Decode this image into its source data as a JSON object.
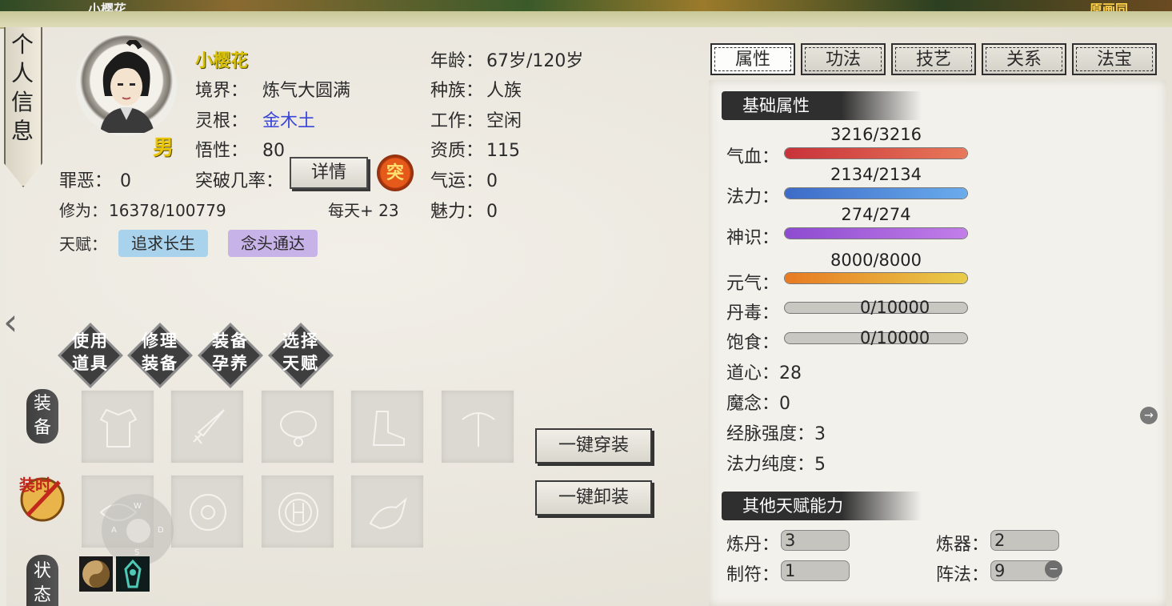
{
  "top_banner": {
    "left_text": "小樱花",
    "right_text": "原画同"
  },
  "side_tab": {
    "label": "个人信息"
  },
  "character": {
    "name": "小樱花",
    "gender": "男",
    "realm_label": "境界：",
    "realm_value": "炼气大圆满",
    "root_label": "灵根：",
    "root_value": "金木土",
    "comprehension_label": "悟性：",
    "comprehension_value": "80",
    "sin_label": "罪恶：",
    "sin_value": "0",
    "breakthrough_label": "突破几率：",
    "detail_button": "详情",
    "tu_icon": "突",
    "cultivation_label": "修为：",
    "cultivation_value": "16378/100779",
    "daily_gain": "每天+ 23",
    "age_label": "年龄：",
    "age_value": "67岁/120岁",
    "race_label": "种族：",
    "race_value": "人族",
    "job_label": "工作：",
    "job_value": "空闲",
    "aptitude_label": "资质：",
    "aptitude_value": "115",
    "luck_label": "气运：",
    "luck_value": "0",
    "charm_label": "魅力：",
    "charm_value": "0",
    "talent_label": "天赋：",
    "talents": [
      "追求长生",
      "念头通达"
    ]
  },
  "actions": [
    "使用道具",
    "修理装备",
    "装备孕养",
    "选择天赋"
  ],
  "equipment": {
    "section_label": "装备",
    "fashion_label": "装时",
    "status_label": "状态",
    "equip_all": "一键穿装",
    "unequip_all": "一键卸装",
    "joystick": {
      "w": "W",
      "a": "A",
      "s": "S",
      "d": "D"
    }
  },
  "tabs": [
    "属性",
    "功法",
    "技艺",
    "关系",
    "法宝"
  ],
  "active_tab": "属性",
  "basic_attributes": {
    "title": "基础属性",
    "items": [
      {
        "label": "气血：",
        "value": "3216/3216",
        "ratio": 1.0,
        "color": "#c8323a"
      },
      {
        "label": "法力：",
        "value": "2134/2134",
        "ratio": 1.0,
        "color": "#3d6bc8"
      },
      {
        "label": "神识：",
        "value": "274/274",
        "ratio": 1.0,
        "color": "#8d4bd0"
      },
      {
        "label": "元气：",
        "value": "8000/8000",
        "ratio": 1.0,
        "color": "#e87a22"
      },
      {
        "label": "丹毒：",
        "value": "0/10000",
        "ratio": 0.0,
        "color": "#c9c7c2"
      },
      {
        "label": "饱食：",
        "value": "0/10000",
        "ratio": 0.0,
        "color": "#c9c7c2"
      }
    ],
    "dao_heart_label": "道心：",
    "dao_heart_value": "28",
    "demon_label": "魔念：",
    "demon_value": "0",
    "meridian_label": "经脉强度：",
    "meridian_value": "3",
    "mana_purity_label": "法力纯度：",
    "mana_purity_value": "5"
  },
  "other_talents": {
    "title": "其他天赋能力",
    "alchemy_label": "炼丹：",
    "alchemy_value": "3",
    "forging_label": "炼器：",
    "forging_value": "2",
    "talisman_label": "制符：",
    "talisman_value": "1",
    "formation_label": "阵法：",
    "formation_value": "9"
  }
}
